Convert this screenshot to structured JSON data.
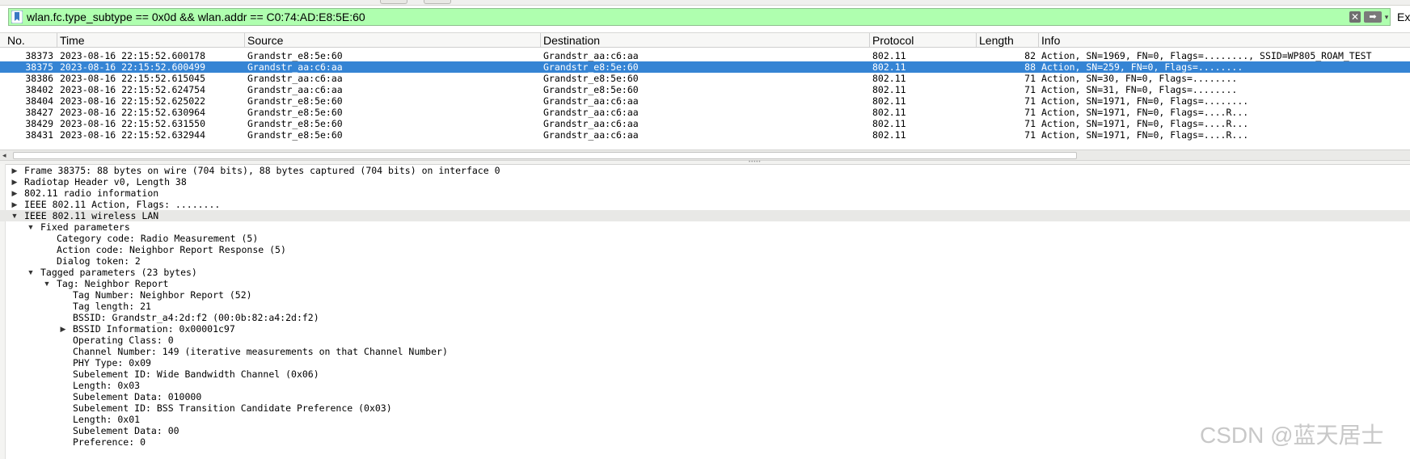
{
  "filter": {
    "value": "wlan.fc.type_subtype == 0x0d && wlan.addr == C0:74:AD:E8:5E:60",
    "background": "#afffaf",
    "bookmark_icon": "bookmark-icon",
    "clear_icon": "clear-icon",
    "clear_glyph": "✕",
    "apply_icon": "arrow-right-icon",
    "apply_glyph": "➡",
    "history_icon": "chevron-down-icon",
    "history_glyph": "▾"
  },
  "expression_button": "Ex",
  "columns": [
    "No.",
    "Time",
    "Source",
    "Destination",
    "Protocol",
    "Length",
    "Info"
  ],
  "packets": [
    {
      "no": "38373",
      "time": "2023-08-16 22:15:52.600178",
      "source": "Grandstr_e8:5e:60",
      "destination": "Grandstr_aa:c6:aa",
      "protocol": "802.11",
      "length": "82",
      "info": "Action, SN=1969, FN=0, Flags=........, SSID=WP805_ROAM_TEST",
      "selected": false
    },
    {
      "no": "38375",
      "time": "2023-08-16 22:15:52.600499",
      "source": "Grandstr_aa:c6:aa",
      "destination": "Grandstr_e8:5e:60",
      "protocol": "802.11",
      "length": "88",
      "info": "Action, SN=259, FN=0, Flags=........",
      "selected": true
    },
    {
      "no": "38386",
      "time": "2023-08-16 22:15:52.615045",
      "source": "Grandstr_aa:c6:aa",
      "destination": "Grandstr_e8:5e:60",
      "protocol": "802.11",
      "length": "71",
      "info": "Action, SN=30, FN=0, Flags=........",
      "selected": false
    },
    {
      "no": "38402",
      "time": "2023-08-16 22:15:52.624754",
      "source": "Grandstr_aa:c6:aa",
      "destination": "Grandstr_e8:5e:60",
      "protocol": "802.11",
      "length": "71",
      "info": "Action, SN=31, FN=0, Flags=........",
      "selected": false
    },
    {
      "no": "38404",
      "time": "2023-08-16 22:15:52.625022",
      "source": "Grandstr_e8:5e:60",
      "destination": "Grandstr_aa:c6:aa",
      "protocol": "802.11",
      "length": "71",
      "info": "Action, SN=1971, FN=0, Flags=........",
      "selected": false
    },
    {
      "no": "38427",
      "time": "2023-08-16 22:15:52.630964",
      "source": "Grandstr_e8:5e:60",
      "destination": "Grandstr_aa:c6:aa",
      "protocol": "802.11",
      "length": "71",
      "info": "Action, SN=1971, FN=0, Flags=....R...",
      "selected": false
    },
    {
      "no": "38429",
      "time": "2023-08-16 22:15:52.631550",
      "source": "Grandstr_e8:5e:60",
      "destination": "Grandstr_aa:c6:aa",
      "protocol": "802.11",
      "length": "71",
      "info": "Action, SN=1971, FN=0, Flags=....R...",
      "selected": false
    },
    {
      "no": "38431",
      "time": "2023-08-16 22:15:52.632944",
      "source": "Grandstr_e8:5e:60",
      "destination": "Grandstr_aa:c6:aa",
      "protocol": "802.11",
      "length": "71",
      "info": "Action, SN=1971, FN=0, Flags=....R...",
      "selected": false
    }
  ],
  "selection_color": "#3584d4",
  "details": [
    {
      "level": 0,
      "toggle": "collapsed",
      "text": "Frame 38375: 88 bytes on wire (704 bits), 88 bytes captured (704 bits) on interface 0"
    },
    {
      "level": 0,
      "toggle": "collapsed",
      "text": "Radiotap Header v0, Length 38"
    },
    {
      "level": 0,
      "toggle": "collapsed",
      "text": "802.11 radio information"
    },
    {
      "level": 0,
      "toggle": "collapsed",
      "text": "IEEE 802.11 Action, Flags: ........"
    },
    {
      "level": 0,
      "toggle": "expanded",
      "text": "IEEE 802.11 wireless LAN",
      "highlight": true
    },
    {
      "level": 1,
      "toggle": "expanded",
      "text": "Fixed parameters"
    },
    {
      "level": 2,
      "toggle": "none",
      "text": "Category code: Radio Measurement (5)"
    },
    {
      "level": 2,
      "toggle": "none",
      "text": "Action code: Neighbor Report Response (5)"
    },
    {
      "level": 2,
      "toggle": "none",
      "text": "Dialog token: 2"
    },
    {
      "level": 1,
      "toggle": "expanded",
      "text": "Tagged parameters (23 bytes)"
    },
    {
      "level": 2,
      "toggle": "expanded",
      "text": "Tag: Neighbor Report"
    },
    {
      "level": 3,
      "toggle": "none",
      "text": "Tag Number: Neighbor Report (52)"
    },
    {
      "level": 3,
      "toggle": "none",
      "text": "Tag length: 21"
    },
    {
      "level": 3,
      "toggle": "none",
      "text": "BSSID: Grandstr_a4:2d:f2 (00:0b:82:a4:2d:f2)"
    },
    {
      "level": 3,
      "toggle": "collapsed",
      "text": "BSSID Information: 0x00001c97"
    },
    {
      "level": 3,
      "toggle": "none",
      "text": "Operating Class: 0"
    },
    {
      "level": 3,
      "toggle": "none",
      "text": "Channel Number: 149 (iterative measurements on that Channel Number)"
    },
    {
      "level": 3,
      "toggle": "none",
      "text": "PHY Type: 0x09"
    },
    {
      "level": 3,
      "toggle": "none",
      "text": "Subelement ID: Wide Bandwidth Channel (0x06)"
    },
    {
      "level": 3,
      "toggle": "none",
      "text": "Length: 0x03"
    },
    {
      "level": 3,
      "toggle": "none",
      "text": "Subelement Data: 010000"
    },
    {
      "level": 3,
      "toggle": "none",
      "text": "Subelement ID: BSS Transition Candidate Preference (0x03)"
    },
    {
      "level": 3,
      "toggle": "none",
      "text": "Length: 0x01"
    },
    {
      "level": 3,
      "toggle": "none",
      "text": "Subelement Data: 00"
    },
    {
      "level": 3,
      "toggle": "none",
      "text": "Preference: 0"
    }
  ],
  "scrollbar_left_glyph": "◂",
  "tree_glyphs": {
    "collapsed": "▶",
    "expanded": "▼"
  },
  "watermark": "CSDN @蓝天居士"
}
